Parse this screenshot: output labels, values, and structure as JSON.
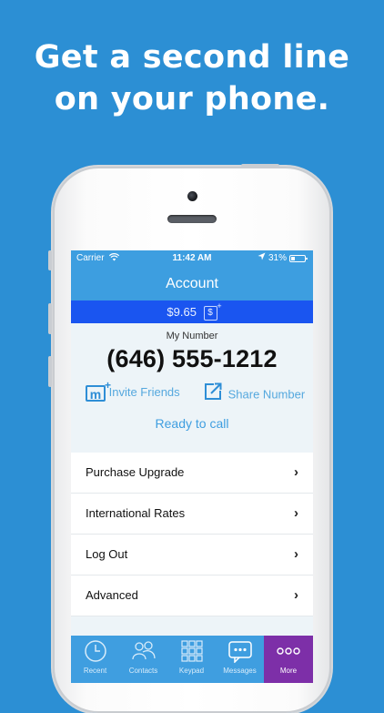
{
  "headline": {
    "line1": "Get a second line",
    "line2": "on your phone."
  },
  "status_bar": {
    "carrier": "Carrier",
    "time": "11:42 AM",
    "battery": "31%"
  },
  "nav": {
    "title": "Account"
  },
  "balance": {
    "amount": "$9.65",
    "icon_glyph": "$"
  },
  "account": {
    "number_label": "My Number",
    "number": "(646) 555-1212",
    "invite_label": "Invite Friends",
    "invite_icon_glyph": "m",
    "share_label": "Share Number",
    "status": "Ready to call"
  },
  "menu": {
    "items": [
      {
        "label": "Purchase Upgrade"
      },
      {
        "label": "International Rates"
      },
      {
        "label": "Log Out"
      },
      {
        "label": "Advanced"
      }
    ]
  },
  "tabs": [
    {
      "label": "Recent",
      "icon": "clock-icon"
    },
    {
      "label": "Contacts",
      "icon": "contacts-icon"
    },
    {
      "label": "Keypad",
      "icon": "keypad-icon"
    },
    {
      "label": "Messages",
      "icon": "messages-icon"
    },
    {
      "label": "More",
      "icon": "more-icon",
      "active": true
    }
  ],
  "colors": {
    "background": "#2c8fd4",
    "accent": "#3d9ee0",
    "balance_bar": "#1a55f0",
    "active_tab": "#7d2fa8"
  }
}
